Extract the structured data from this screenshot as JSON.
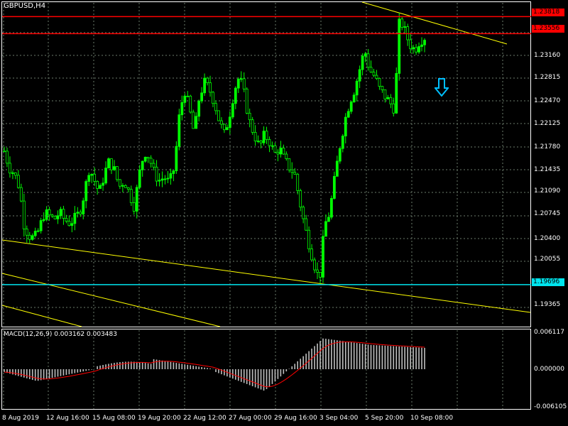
{
  "window": {
    "symbol_title": "GBPUSD,H4"
  },
  "macd": {
    "title": "MACD(12,26,9) 0.003162 0.003483",
    "scale": [
      "0.006117",
      "0.000000",
      "-0.006105"
    ]
  },
  "price_axis": {
    "labels": [
      "1.23160",
      "1.22815",
      "1.22470",
      "1.22125",
      "1.21780",
      "1.21435",
      "1.21090",
      "1.20745",
      "1.20400",
      "1.20055",
      "1.19365"
    ]
  },
  "level_tags": {
    "upper_red": "1.23818",
    "lower_red": "1.23556",
    "cyan": "1.19696"
  },
  "time_axis": {
    "labels": [
      "8 Aug 2019",
      "12 Aug 16:00",
      "15 Aug 08:00",
      "19 Aug 20:00",
      "22 Aug 12:00",
      "27 Aug 00:00",
      "29 Aug 16:00",
      "3 Sep 04:00",
      "5 Sep 20:00",
      "10 Sep 08:00"
    ]
  },
  "colors": {
    "background": "#000000",
    "grid": "#6b7b6b",
    "candle": "#00ff00",
    "red_level": "#ff0000",
    "cyan_level": "#00e5ee",
    "trendline": "#ffff00",
    "arrow": "#00bfff",
    "macd_hist": "#c0c0c0",
    "macd_signal": "#ff0000"
  },
  "chart_data": {
    "type": "candlestick",
    "symbol": "GBPUSD",
    "timeframe": "H4",
    "ylim": [
      1.1905,
      1.2404
    ],
    "approx_close_path": [
      1.2175,
      1.215,
      1.214,
      1.212,
      1.206,
      1.2045,
      1.204,
      1.2055,
      1.208,
      1.2075,
      1.207,
      1.208,
      1.207,
      1.2065,
      1.207,
      1.208,
      1.211,
      1.215,
      1.213,
      1.211,
      1.214,
      1.216,
      1.2145,
      1.212,
      1.213,
      1.211,
      1.209,
      1.214,
      1.2175,
      1.2165,
      1.214,
      1.213,
      1.2135,
      1.2125,
      1.215,
      1.223,
      1.227,
      1.224,
      1.22,
      1.226,
      1.228,
      1.227,
      1.225,
      1.222,
      1.22,
      1.223,
      1.227,
      1.229,
      1.226,
      1.222,
      1.22,
      1.218,
      1.22,
      1.219,
      1.217,
      1.218,
      1.216,
      1.215,
      1.214,
      1.21,
      1.206,
      1.203,
      1.2,
      1.1975,
      1.206,
      1.208,
      1.213,
      1.218,
      1.222,
      1.225,
      1.227,
      1.23,
      1.233,
      1.23,
      1.229,
      1.227,
      1.226,
      1.225,
      1.224,
      1.238,
      1.236,
      1.234,
      1.233,
      1.2345,
      1.235
    ],
    "levels": [
      {
        "name": "upper_red",
        "value": 1.23818
      },
      {
        "name": "lower_red",
        "value": 1.23556
      },
      {
        "name": "cyan",
        "value": 1.19696
      }
    ]
  }
}
